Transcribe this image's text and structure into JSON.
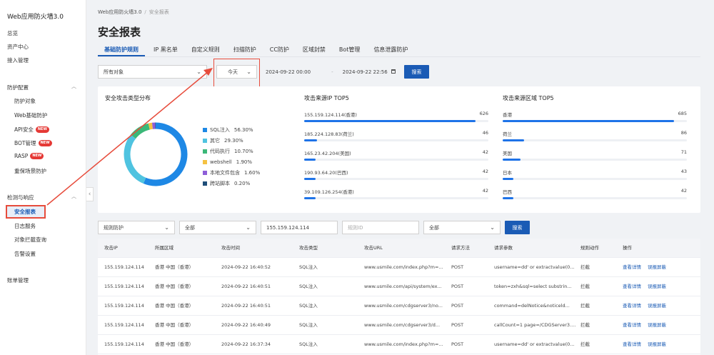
{
  "sidebar": {
    "app_title": "Web应用防火墙3.0",
    "items": {
      "overview": "总览",
      "assets": "资产中心",
      "access": "接入管理",
      "protect_group": "防护配置",
      "protect_target": "防护对象",
      "web_basic": "Web基础防护",
      "api_security": "API安全",
      "bot_mgmt": "BOT管理",
      "rasp": "RASP",
      "major_event": "重保场景防护",
      "detect_group": "检测与响应",
      "security_report": "安全报表",
      "log_service": "日志服务",
      "block_query": "对象拦截查询",
      "alert_settings": "告警设置",
      "account": "账单管理"
    },
    "new_badge": "NEW"
  },
  "breadcrumb": {
    "root": "Web应用防火墙3.0",
    "sep": "/",
    "current": "安全报表"
  },
  "page_title": "安全报表",
  "tabs": [
    "基础防护规则",
    "IP 黑名单",
    "自定义规则",
    "扫描防护",
    "CC防护",
    "区域封禁",
    "Bot管理",
    "信息泄露防护"
  ],
  "filters": {
    "object": "所有对象",
    "range": "今天",
    "start": "2024-09-22 00:00",
    "dash": "-",
    "end": "2024-09-22 22:56",
    "search": "搜索"
  },
  "attack_types": {
    "title": "安全攻击类型分布",
    "items": [
      {
        "name": "SQL注入",
        "pct": "56.30%",
        "value": 56.3,
        "color": "#1e88e5"
      },
      {
        "name": "其它",
        "pct": "29.30%",
        "value": 29.3,
        "color": "#4fc3e0"
      },
      {
        "name": "代码执行",
        "pct": "10.70%",
        "value": 10.7,
        "color": "#3bb878"
      },
      {
        "name": "webshell",
        "pct": "1.90%",
        "value": 1.9,
        "color": "#f5c242"
      },
      {
        "name": "本地文件包含",
        "pct": "1.60%",
        "value": 1.6,
        "color": "#8e5ed8"
      },
      {
        "name": "跨站脚本",
        "pct": "0.20%",
        "value": 0.2,
        "color": "#1f4e79"
      }
    ]
  },
  "top_ip": {
    "title": "攻击来源IP TOP5",
    "items": [
      {
        "label": "155.159.124.114(香港)",
        "value": 626
      },
      {
        "label": "185.224.128.83(荷兰)",
        "value": 46
      },
      {
        "label": "165.23.42.204(美国)",
        "value": 42
      },
      {
        "label": "190.93.64.20(巴西)",
        "value": 42
      },
      {
        "label": "39.109.126.254(香港)",
        "value": 42
      }
    ]
  },
  "top_region": {
    "title": "攻击来源区域 TOP5",
    "items": [
      {
        "label": "香港",
        "value": 685
      },
      {
        "label": "荷兰",
        "value": 86
      },
      {
        "label": "美国",
        "value": 71
      },
      {
        "label": "日本",
        "value": 43
      },
      {
        "label": "巴西",
        "value": 42
      }
    ]
  },
  "table_filters": {
    "rule": "规则防护",
    "all1": "全部",
    "ip": "155.159.124.114",
    "rule_id_placeholder": "规则ID",
    "all2": "全部",
    "search": "搜索"
  },
  "table": {
    "columns": [
      "攻击IP",
      "所属区域",
      "攻击时间",
      "攻击类型",
      "攻击URL",
      "请求方法",
      "请求参数",
      "规则动作",
      "操作"
    ],
    "rows": [
      [
        "155.159.124.114",
        "香港 中国（香港）",
        "2024-09-22 16:40:52",
        "SQL注入",
        "www.usmile.com/index.php?m=...",
        "POST",
        "username=dd' or extractvalue(0...",
        "拦截"
      ],
      [
        "155.159.124.114",
        "香港 中国（香港）",
        "2024-09-22 16:40:51",
        "SQL注入",
        "www.usmile.com/api/system/ex...",
        "POST",
        "token=zxh&sql=select substrin...",
        "拦截"
      ],
      [
        "155.159.124.114",
        "香港 中国（香港）",
        "2024-09-22 16:40:51",
        "SQL注入",
        "www.usmile.com/cdgserver3/no...",
        "POST",
        "command=delNotice&noticeld...",
        "拦截"
      ],
      [
        "155.159.124.114",
        "香港 中国（香港）",
        "2024-09-22 16:40:49",
        "SQL注入",
        "www.usmile.com/cdgserver3/d...",
        "POST",
        "callCount=1 page=/CDGServer3....",
        "拦截"
      ],
      [
        "155.159.124.114",
        "香港 中国（香港）",
        "2024-09-22 16:37:34",
        "SQL注入",
        "www.usmile.com/index.php?m=...",
        "POST",
        "username=dd' or extractvalue(0...",
        "拦截"
      ]
    ],
    "op_detail": "查看详情",
    "op_false": "误报屏蔽"
  }
}
